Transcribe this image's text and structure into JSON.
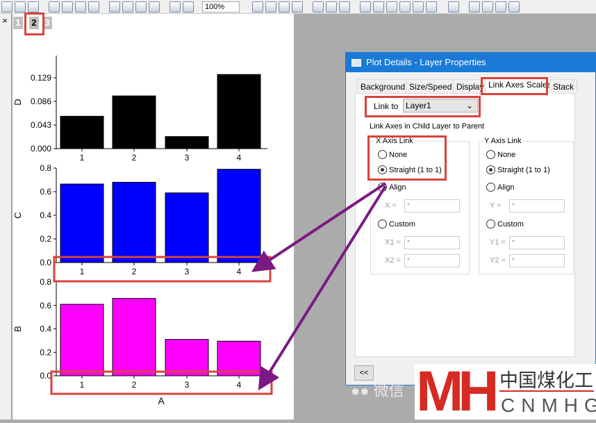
{
  "toolbar": {
    "zoom": "100%"
  },
  "graph": {
    "layer_tabs": [
      "1",
      "2",
      "3"
    ],
    "active_layer": "2",
    "x_axis_title": "A",
    "layers": [
      {
        "y_title": "D",
        "color": "#000000",
        "categories": [
          "1",
          "2",
          "3",
          "4"
        ],
        "values": [
          0.059,
          0.096,
          0.022,
          0.135
        ],
        "yticks": [
          "0.000",
          "0.043",
          "0.086",
          "0.129"
        ],
        "ylim": [
          0,
          0.16
        ]
      },
      {
        "y_title": "C",
        "color": "#0000ff",
        "categories": [
          "1",
          "2",
          "3",
          "4"
        ],
        "values": [
          0.665,
          0.68,
          0.59,
          0.79
        ],
        "yticks": [
          "0.0",
          "0.2",
          "0.4",
          "0.6",
          "0.8"
        ],
        "ylim": [
          0,
          0.8
        ]
      },
      {
        "y_title": "B",
        "color": "#ff00ff",
        "categories": [
          "1",
          "2",
          "3",
          "4"
        ],
        "values": [
          0.61,
          0.66,
          0.31,
          0.295
        ],
        "yticks": [
          "0.0",
          "0.2",
          "0.4",
          "0.6",
          "0.8"
        ],
        "ylim": [
          0,
          0.8
        ]
      }
    ]
  },
  "dialog": {
    "title": "Plot Details - Layer Properties",
    "tabs": [
      "Background",
      "Size/Speed",
      "Display",
      "Link Axes Scales",
      "Stack"
    ],
    "link_to_label": "Link to",
    "link_to_value": "Layer1",
    "section_label": "Link Axes in Child Layer to Parent",
    "x_group": {
      "title": "X Axis Link",
      "options": [
        "None",
        "Straight (1 to 1)",
        "Align",
        "Custom"
      ],
      "selected": "Straight (1 to 1)",
      "x_label": "X =",
      "x1_label": "X1 =",
      "x2_label": "X2 =",
      "x_value": "*",
      "x1_value": "*",
      "x2_value": "*"
    },
    "y_group": {
      "title": "Y Axis Link",
      "options": [
        "None",
        "Straight (1 to 1)",
        "Align",
        "Custom"
      ],
      "selected": "Straight (1 to 1)",
      "y_label": "Y =",
      "y1_label": "Y1 =",
      "y2_label": "Y2 =",
      "y_value": "*",
      "y1_value": "*",
      "y2_value": "*"
    },
    "collapse_label": "<<"
  },
  "watermark": {
    "wechat": "微信",
    "logo_cn": "中国煤化工",
    "logo_en": "CNMHG",
    "logo_mark": "MH"
  },
  "colors": {
    "annotation_red": "#d9423c",
    "arrow_purple": "#7b1a83",
    "title_blue": "#1a7ad6"
  }
}
